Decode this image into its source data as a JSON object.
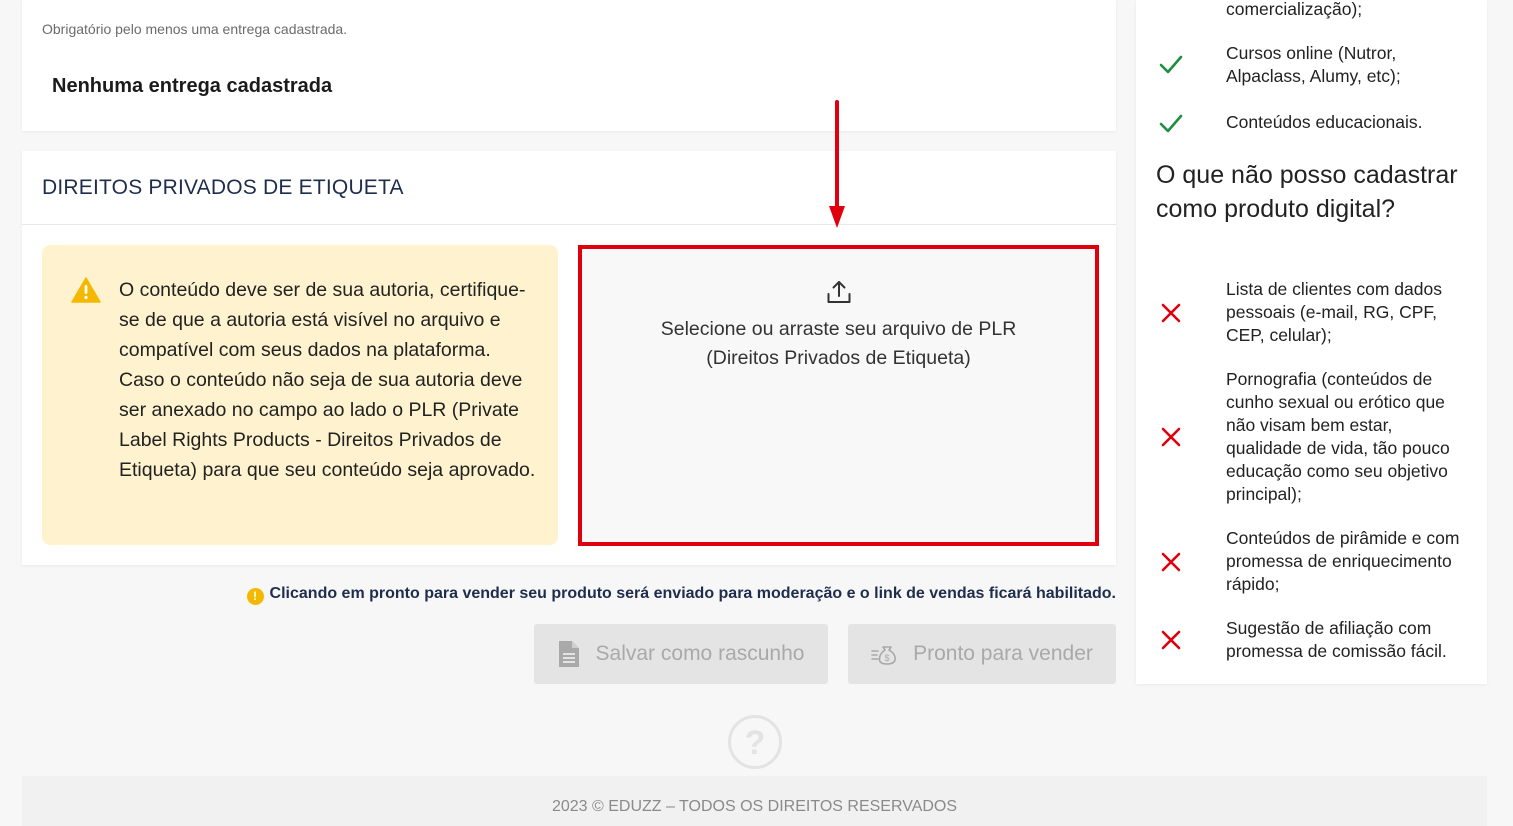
{
  "deliveries": {
    "hint": "Obrigatório pelo menos uma entrega cadastrada.",
    "empty_text": "Nenhuma entrega cadastrada"
  },
  "plr": {
    "title": "DIREITOS PRIVADOS DE ETIQUETA",
    "alert_text": "O conteúdo deve ser de sua autoria, certifique-se de que a autoria está visível no arquivo e compatível com seus dados na plataforma. Caso o conteúdo não seja de sua autoria deve ser anexado no campo ao lado o PLR (Private Label Rights Products - Direitos Privados de Etiqueta) para que seu conteúdo seja aprovado.",
    "dropzone_line1": "Selecione ou arraste seu arquivo de PLR",
    "dropzone_line2": "(Direitos Privados de Etiqueta)",
    "alert_icon": "warning-icon",
    "upload_icon": "upload-icon"
  },
  "notice": {
    "dot": "!",
    "text": "Clicando em pronto para vender seu produto será enviado para moderação e o link de vendas ficará habilitado."
  },
  "actions": {
    "save_draft": "Salvar como rascunho",
    "ready_to_sell": "Pronto para vender"
  },
  "footer": {
    "text": "2023 © EDUZZ – TODOS OS DIREITOS RESERVADOS"
  },
  "sidebar": {
    "allowed": [
      {
        "text": "comercialização);",
        "icon": "check-icon"
      },
      {
        "text": "Cursos online (Nutror, Alpaclass, Alumy, etc);",
        "icon": "check-icon"
      },
      {
        "text": "Conteúdos educacionais.",
        "icon": "check-icon"
      }
    ],
    "heading": "O que não posso cadastrar como produto digital?",
    "forbidden": [
      {
        "text": "Lista de clientes com dados pessoais (e-mail, RG, CPF, CEP, celular);",
        "icon": "cross-icon"
      },
      {
        "text": "Pornografia (conteúdos de cunho sexual ou erótico que não visam bem estar, qualidade de vida, tão pouco educação como seu objetivo principal);",
        "icon": "cross-icon"
      },
      {
        "text": "Conteúdos de pirâmide e com promessa de enriquecimento rápido;",
        "icon": "cross-icon"
      },
      {
        "text": "Sugestão de afiliação com promessa de comissão fácil.",
        "icon": "cross-icon"
      }
    ]
  },
  "colors": {
    "highlight": "#e0000d",
    "check": "#1e8e3e",
    "cross": "#e0000d",
    "alert_bg": "#fff3cf",
    "warning": "#f5b800"
  }
}
